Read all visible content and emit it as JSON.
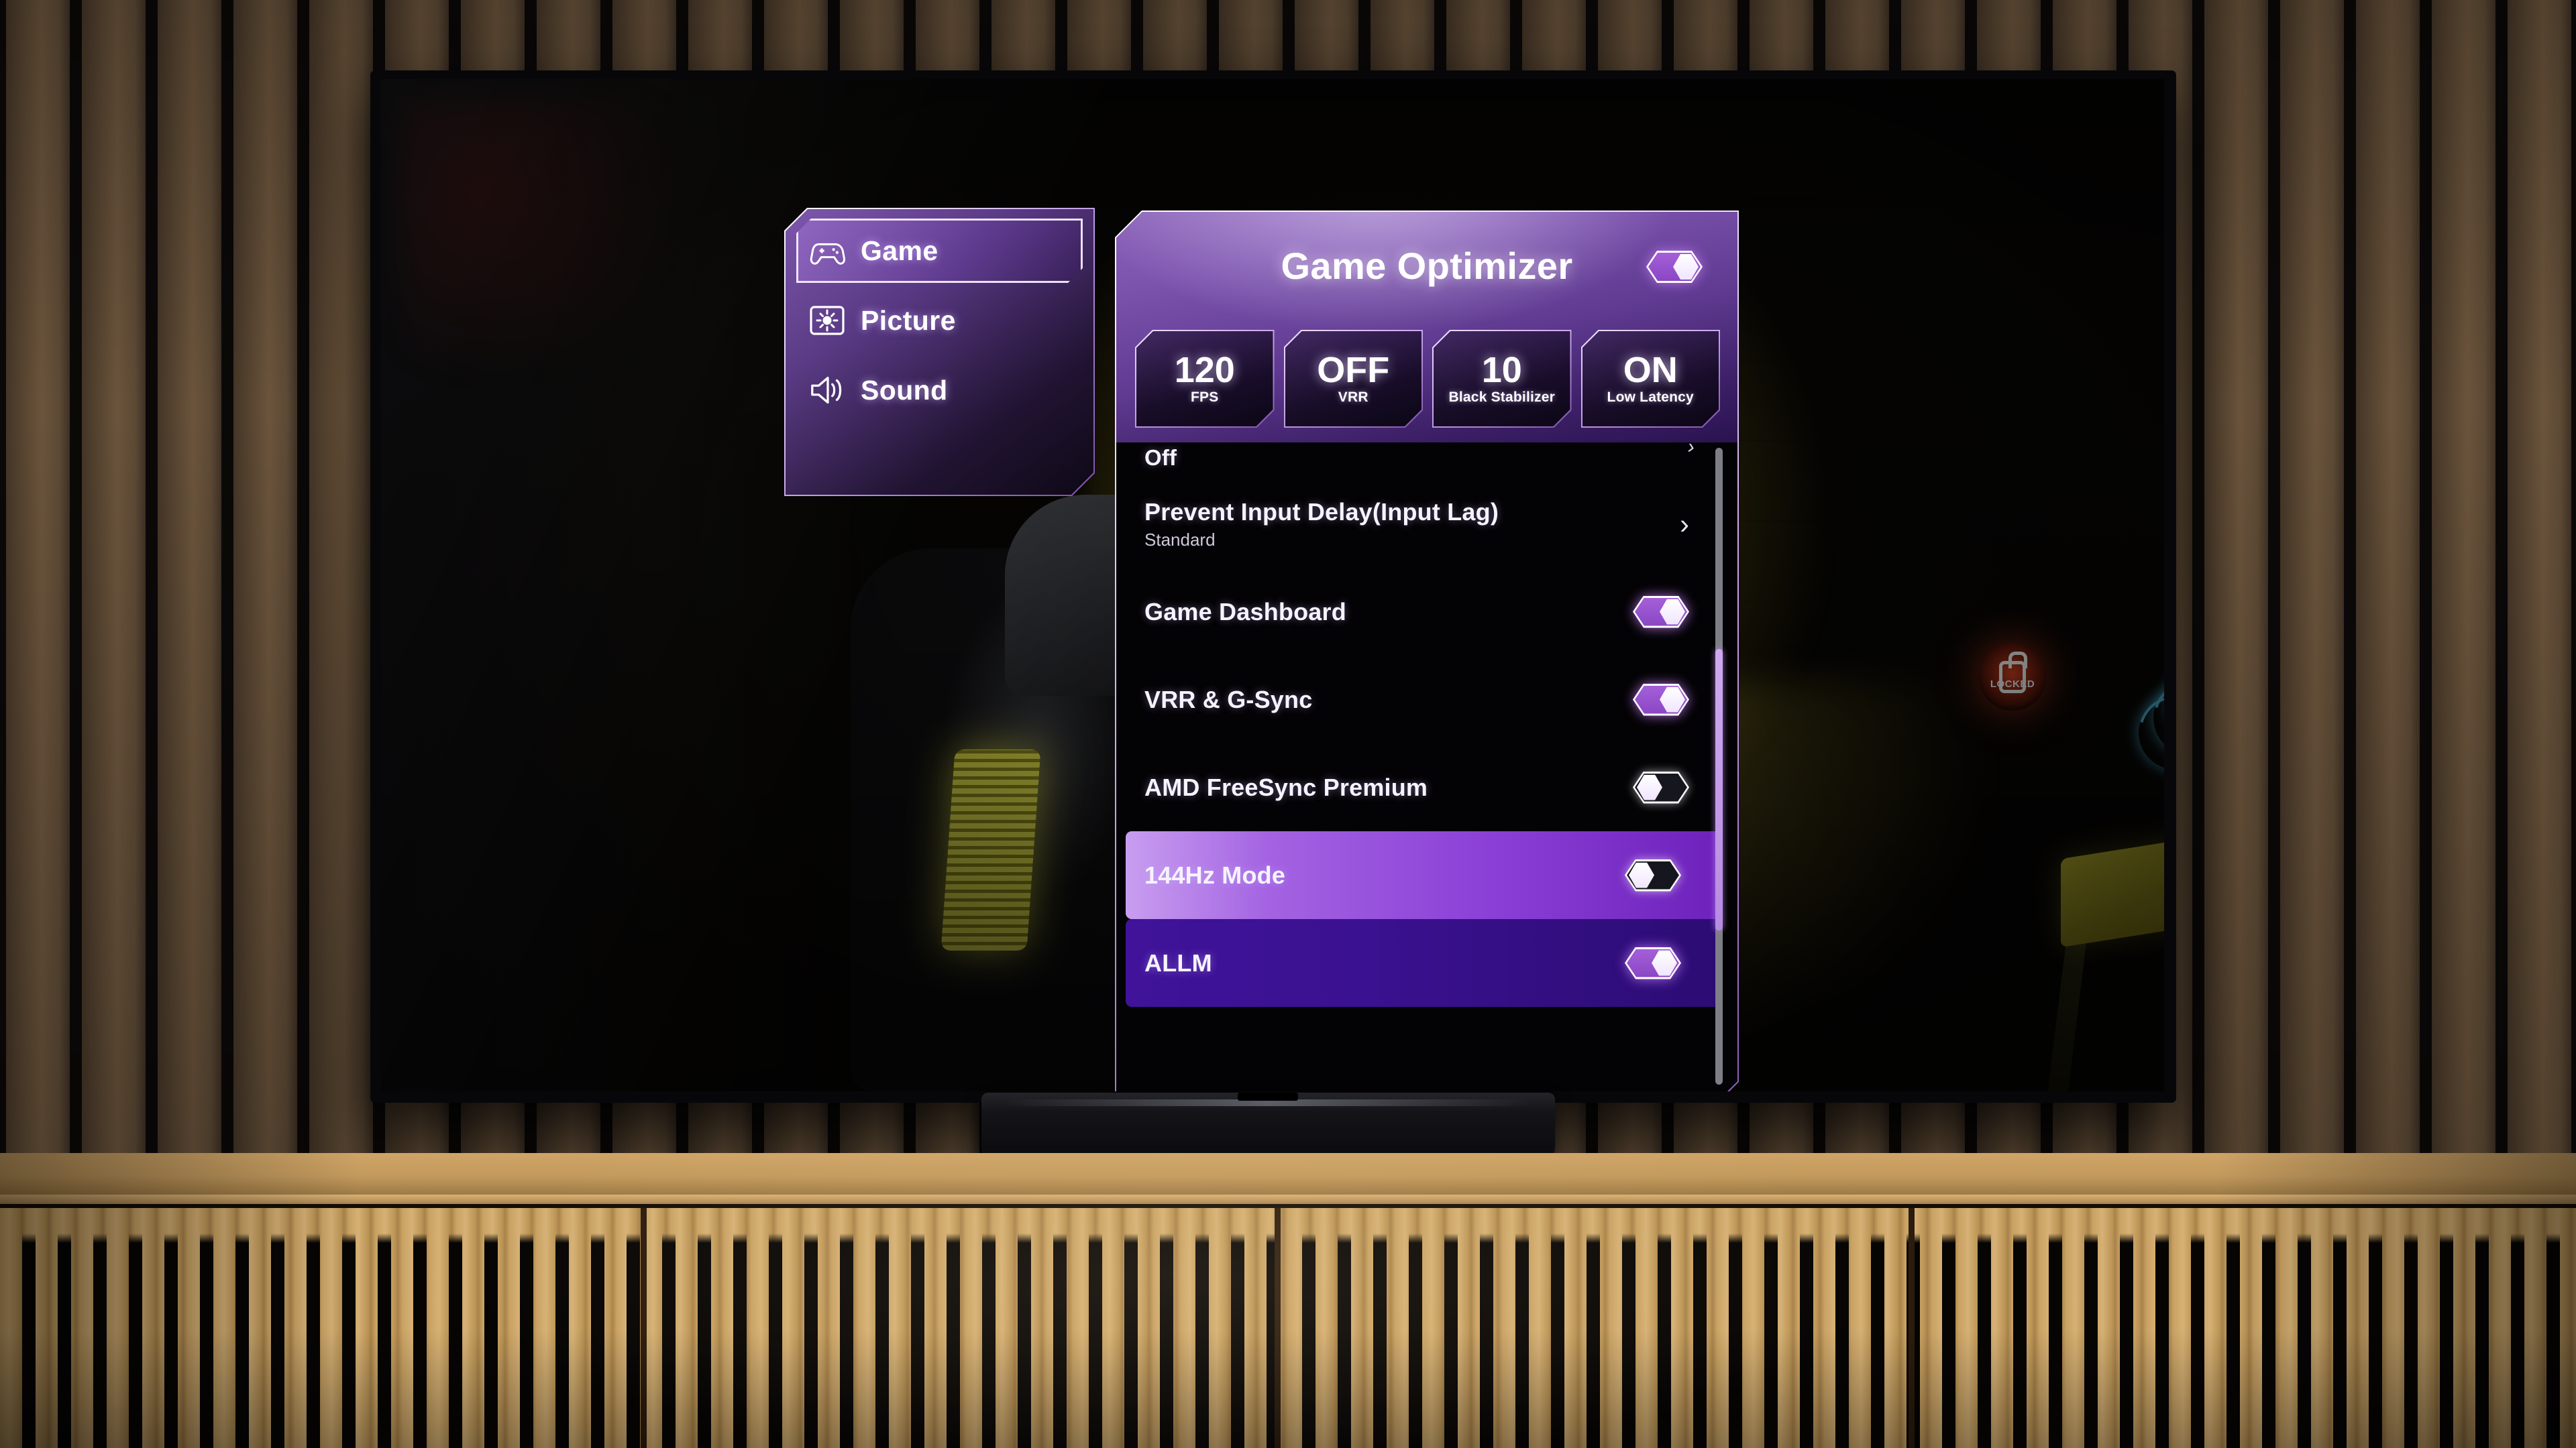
{
  "sidebar": {
    "items": [
      {
        "label": "Game",
        "icon": "gamepad-icon",
        "selected": true
      },
      {
        "label": "Picture",
        "icon": "brightness-icon",
        "selected": false
      },
      {
        "label": "Sound",
        "icon": "speaker-icon",
        "selected": false
      }
    ]
  },
  "panel": {
    "title": "Game Optimizer",
    "master_toggle": {
      "state": "on",
      "icon": "toggle-on-icon"
    },
    "stats": [
      {
        "value": "120",
        "label": "FPS"
      },
      {
        "value": "OFF",
        "label": "VRR"
      },
      {
        "value": "10",
        "label": "Black Stabilizer"
      },
      {
        "value": "ON",
        "label": "Low Latency"
      }
    ],
    "rows": [
      {
        "type": "partial",
        "label": "Off"
      },
      {
        "type": "submenu",
        "label": "Prevent Input Delay(Input Lag)",
        "sub": "Standard",
        "chevron": "›"
      },
      {
        "type": "toggle",
        "label": "Game Dashboard",
        "state": "on",
        "style": "plain"
      },
      {
        "type": "toggle",
        "label": "VRR & G-Sync",
        "state": "on",
        "style": "plain"
      },
      {
        "type": "toggle",
        "label": "AMD FreeSync Premium",
        "state": "off",
        "style": "plain"
      },
      {
        "type": "toggle",
        "label": "144Hz Mode",
        "state": "off",
        "style": "highlight"
      },
      {
        "type": "toggle",
        "label": "ALLM",
        "state": "on",
        "style": "dim-purple"
      }
    ],
    "scrollbar": {
      "position_pct": 46
    }
  },
  "game_scene": {
    "sign_arrow": "↑",
    "locked_label": "LOCKED"
  },
  "colors": {
    "accent_purple": "#8a46c4",
    "accent_light": "#c89ef0",
    "panel_border": "#ffffff",
    "highlight_start": "#c89ef0",
    "highlight_end": "#6d22bb",
    "toggle_on": "#a45fd8",
    "toggle_off": "#16161e",
    "scrollbar_thumb": "#b88be3",
    "scrollbar_track": "#7e7e86",
    "wall_wood": "#5a4732",
    "cabinet_wood": "#c9a263",
    "scene_yellow": "#d8df4b",
    "locked_red": "#e24624"
  }
}
